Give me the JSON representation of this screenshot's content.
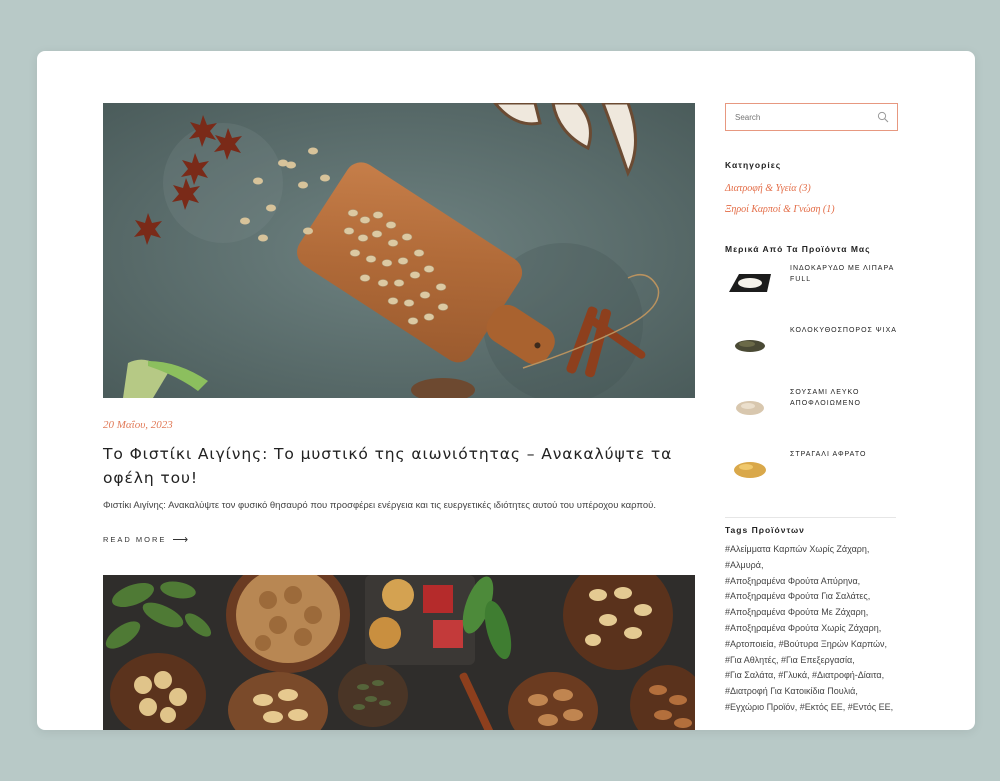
{
  "post": {
    "date": "20 Μαΐου, 2023",
    "title": "Το Φιστίκι Αιγίνης: Το μυστικό της αιωνιότητας – Ανακαλύψτε τα οφέλη του!",
    "excerpt": "Φιστίκι Αιγίνης: Ανακαλύψτε τον φυσικό θησαυρό που προσφέρει ενέργεια και τις ευεργετικές ιδιότητες αυτού του υπέροχου καρπού.",
    "read_more": "READ MORE",
    "read_more_arrow": "⟶"
  },
  "sidebar": {
    "search_placeholder": "Search",
    "categories_heading": "Κατηγορίες",
    "categories": [
      {
        "label": "Διατροφή & Υγεία (3)"
      },
      {
        "label": "Ξηροί Καρποί & Γνώση (1)"
      }
    ],
    "products_heading": "Μερικά Από Τα Προϊόντα Μας",
    "products": [
      {
        "name": "ΙΝΔΟΚΑΡΥΔΟ ΜΕ ΛΙΠΑΡΑ FULL"
      },
      {
        "name": "ΚΟΛΟΚΥΘΟΣΠΟΡΟΣ ΨΙΧΑ"
      },
      {
        "name": "ΣΟΥΣΑΜΙ ΛΕΥΚΟ ΑΠΟΦΛΟΙΩΜΕΝΟ"
      },
      {
        "name": "ΣΤΡΑΓΑΛΙ ΑΦΡΑΤΟ"
      }
    ],
    "tags_heading": "Tags Προϊόντων",
    "tags": [
      "#Αλείμματα Καρπών Χωρίς Ζάχαρη,",
      "#Αλμυρά,",
      "#Αποξηραμένα Φρούτα Απύρηνα,",
      "#Αποξηραμένα Φρούτα Για Σαλάτες,",
      "#Αποξηραμένα Φρούτα Με Ζάχαρη,",
      "#Αποξηραμένα Φρούτα Χωρίς Ζάχαρη,",
      "#Αρτοποιεία,",
      "#Βούτυρα Ξηρών Καρπών,",
      "#Για Αθλητές,",
      "#Για Επεξεργασία,",
      "#Για Σαλάτα,",
      "#Γλυκά,",
      "#Διατροφή-Δίαιτα,",
      "#Διατροφή Για Κατοικίδια Πουλιά,",
      "#Εγχώριο Προϊόν,",
      "#Εκτός ΕΕ,",
      "#Εντός ΕΕ,"
    ]
  }
}
